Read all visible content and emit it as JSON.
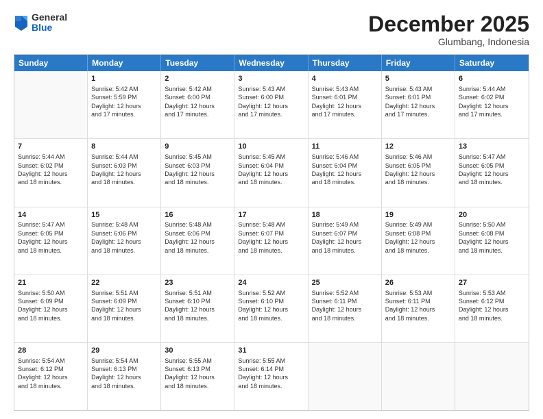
{
  "logo": {
    "general": "General",
    "blue": "Blue"
  },
  "title": "December 2025",
  "subtitle": "Glumbang, Indonesia",
  "days": [
    "Sunday",
    "Monday",
    "Tuesday",
    "Wednesday",
    "Thursday",
    "Friday",
    "Saturday"
  ],
  "rows": [
    [
      {
        "day": "",
        "info": ""
      },
      {
        "day": "1",
        "info": "Sunrise: 5:42 AM\nSunset: 5:59 PM\nDaylight: 12 hours\nand 17 minutes."
      },
      {
        "day": "2",
        "info": "Sunrise: 5:42 AM\nSunset: 6:00 PM\nDaylight: 12 hours\nand 17 minutes."
      },
      {
        "day": "3",
        "info": "Sunrise: 5:43 AM\nSunset: 6:00 PM\nDaylight: 12 hours\nand 17 minutes."
      },
      {
        "day": "4",
        "info": "Sunrise: 5:43 AM\nSunset: 6:01 PM\nDaylight: 12 hours\nand 17 minutes."
      },
      {
        "day": "5",
        "info": "Sunrise: 5:43 AM\nSunset: 6:01 PM\nDaylight: 12 hours\nand 17 minutes."
      },
      {
        "day": "6",
        "info": "Sunrise: 5:44 AM\nSunset: 6:02 PM\nDaylight: 12 hours\nand 17 minutes."
      }
    ],
    [
      {
        "day": "7",
        "info": "Sunrise: 5:44 AM\nSunset: 6:02 PM\nDaylight: 12 hours\nand 18 minutes."
      },
      {
        "day": "8",
        "info": "Sunrise: 5:44 AM\nSunset: 6:03 PM\nDaylight: 12 hours\nand 18 minutes."
      },
      {
        "day": "9",
        "info": "Sunrise: 5:45 AM\nSunset: 6:03 PM\nDaylight: 12 hours\nand 18 minutes."
      },
      {
        "day": "10",
        "info": "Sunrise: 5:45 AM\nSunset: 6:04 PM\nDaylight: 12 hours\nand 18 minutes."
      },
      {
        "day": "11",
        "info": "Sunrise: 5:46 AM\nSunset: 6:04 PM\nDaylight: 12 hours\nand 18 minutes."
      },
      {
        "day": "12",
        "info": "Sunrise: 5:46 AM\nSunset: 6:05 PM\nDaylight: 12 hours\nand 18 minutes."
      },
      {
        "day": "13",
        "info": "Sunrise: 5:47 AM\nSunset: 6:05 PM\nDaylight: 12 hours\nand 18 minutes."
      }
    ],
    [
      {
        "day": "14",
        "info": "Sunrise: 5:47 AM\nSunset: 6:05 PM\nDaylight: 12 hours\nand 18 minutes."
      },
      {
        "day": "15",
        "info": "Sunrise: 5:48 AM\nSunset: 6:06 PM\nDaylight: 12 hours\nand 18 minutes."
      },
      {
        "day": "16",
        "info": "Sunrise: 5:48 AM\nSunset: 6:06 PM\nDaylight: 12 hours\nand 18 minutes."
      },
      {
        "day": "17",
        "info": "Sunrise: 5:48 AM\nSunset: 6:07 PM\nDaylight: 12 hours\nand 18 minutes."
      },
      {
        "day": "18",
        "info": "Sunrise: 5:49 AM\nSunset: 6:07 PM\nDaylight: 12 hours\nand 18 minutes."
      },
      {
        "day": "19",
        "info": "Sunrise: 5:49 AM\nSunset: 6:08 PM\nDaylight: 12 hours\nand 18 minutes."
      },
      {
        "day": "20",
        "info": "Sunrise: 5:50 AM\nSunset: 6:08 PM\nDaylight: 12 hours\nand 18 minutes."
      }
    ],
    [
      {
        "day": "21",
        "info": "Sunrise: 5:50 AM\nSunset: 6:09 PM\nDaylight: 12 hours\nand 18 minutes."
      },
      {
        "day": "22",
        "info": "Sunrise: 5:51 AM\nSunset: 6:09 PM\nDaylight: 12 hours\nand 18 minutes."
      },
      {
        "day": "23",
        "info": "Sunrise: 5:51 AM\nSunset: 6:10 PM\nDaylight: 12 hours\nand 18 minutes."
      },
      {
        "day": "24",
        "info": "Sunrise: 5:52 AM\nSunset: 6:10 PM\nDaylight: 12 hours\nand 18 minutes."
      },
      {
        "day": "25",
        "info": "Sunrise: 5:52 AM\nSunset: 6:11 PM\nDaylight: 12 hours\nand 18 minutes."
      },
      {
        "day": "26",
        "info": "Sunrise: 5:53 AM\nSunset: 6:11 PM\nDaylight: 12 hours\nand 18 minutes."
      },
      {
        "day": "27",
        "info": "Sunrise: 5:53 AM\nSunset: 6:12 PM\nDaylight: 12 hours\nand 18 minutes."
      }
    ],
    [
      {
        "day": "28",
        "info": "Sunrise: 5:54 AM\nSunset: 6:12 PM\nDaylight: 12 hours\nand 18 minutes."
      },
      {
        "day": "29",
        "info": "Sunrise: 5:54 AM\nSunset: 6:13 PM\nDaylight: 12 hours\nand 18 minutes."
      },
      {
        "day": "30",
        "info": "Sunrise: 5:55 AM\nSunset: 6:13 PM\nDaylight: 12 hours\nand 18 minutes."
      },
      {
        "day": "31",
        "info": "Sunrise: 5:55 AM\nSunset: 6:14 PM\nDaylight: 12 hours\nand 18 minutes."
      },
      {
        "day": "",
        "info": ""
      },
      {
        "day": "",
        "info": ""
      },
      {
        "day": "",
        "info": ""
      }
    ]
  ]
}
